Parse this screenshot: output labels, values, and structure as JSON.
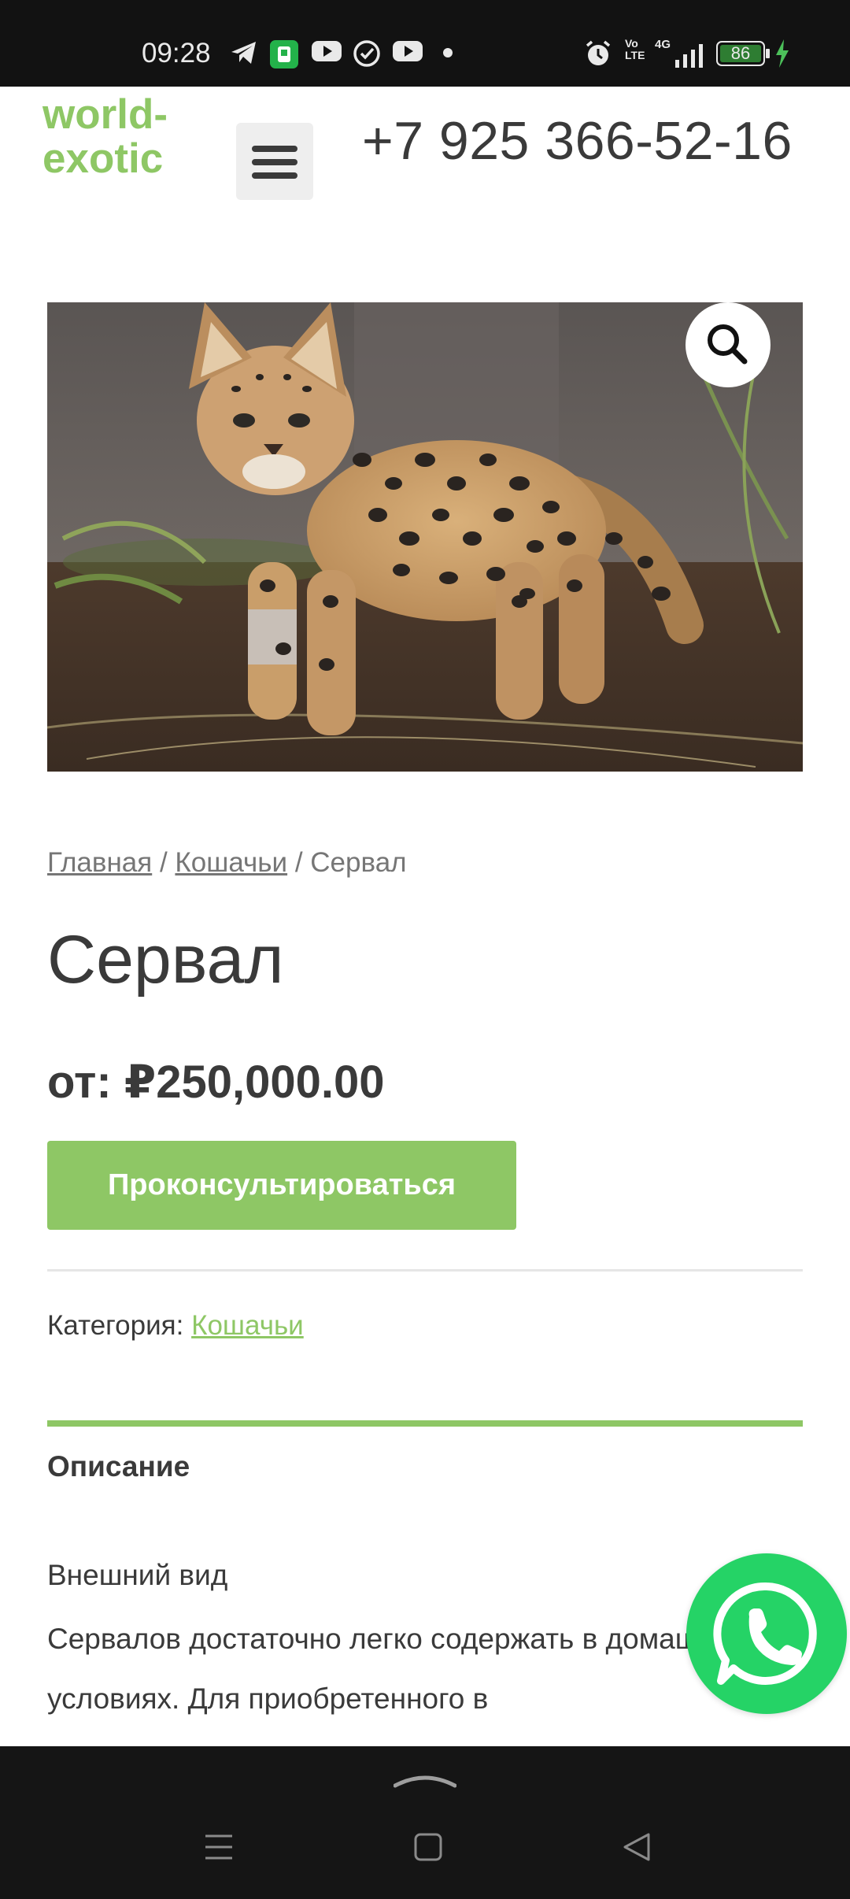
{
  "status_bar": {
    "time": "09:28",
    "battery": "86",
    "network": "4G",
    "volte": "Vo LTE",
    "notification_icons": [
      "telegram-icon",
      "app-icon",
      "youtube-icon",
      "check-circle-icon",
      "youtube-icon",
      "dot-icon"
    ],
    "right_icons": [
      "alarm-icon",
      "volte-icon",
      "signal-icon",
      "battery-icon",
      "charging-icon"
    ]
  },
  "header": {
    "logo_line1": "world-",
    "logo_line2": "exotic",
    "phone": "+7 925 366-52-16",
    "menu_icon": "hamburger-icon"
  },
  "product": {
    "image_alt": "serval-kitten-photo",
    "zoom_icon": "search-icon",
    "breadcrumb": {
      "home": "Главная",
      "sep1": "/",
      "category": "Кошачьи",
      "sep2": "/",
      "current": "Сервал"
    },
    "title": "Сервал",
    "price_prefix": "от:",
    "price": "₽250,000.00",
    "consult_label": "Проконсультироваться",
    "category_label": "Категория:",
    "category_value": "Кошачьи"
  },
  "description": {
    "tab_label": "Описание",
    "heading": "Внешний вид",
    "text": "Сервалов достаточно легко содержать в домашних условиях. Для приобретенного в"
  },
  "colors": {
    "accent": "#8ec765",
    "whatsapp": "#25d366",
    "status_bar_bg": "#121212",
    "nav_bar_bg": "#151515",
    "text": "#3a3a3a"
  },
  "floating": {
    "whatsapp_icon": "whatsapp-icon"
  },
  "nav_bar": {
    "icons": [
      "chevron-up-icon",
      "recents-icon",
      "home-icon",
      "back-icon"
    ]
  }
}
